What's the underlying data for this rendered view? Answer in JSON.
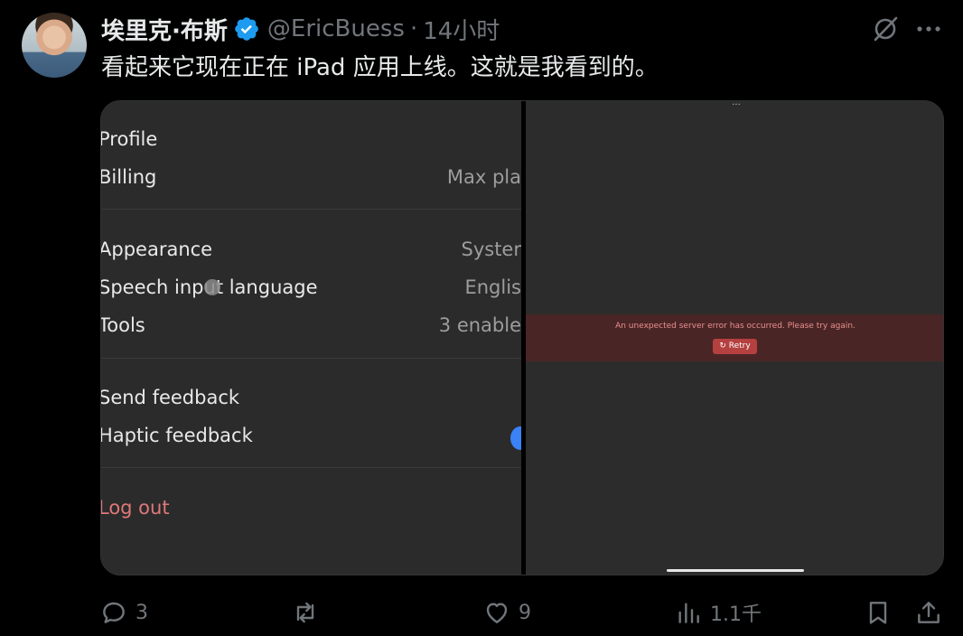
{
  "tweet": {
    "author": "埃里克·布斯",
    "handle": "@EricBuess",
    "separator": "·",
    "time": "14小时",
    "text": "看起来它现在正在 iPad 应用上线。这就是我看到的。"
  },
  "media": {
    "settings": {
      "profile": "Profile",
      "billing": "Billing",
      "billing_value": "Max pla",
      "appearance": "Appearance",
      "appearance_value": "Syster",
      "speech": "Speech input language",
      "speech_value": "Englis",
      "tools": "Tools",
      "tools_value": "3 enable",
      "send_feedback": "Send feedback",
      "haptic": "Haptic feedback",
      "logout": "Log out"
    },
    "handle_dots": "···",
    "error": {
      "message": "An unexpected server error has occurred. Please try again.",
      "retry": "Retry",
      "retry_icon": "↻"
    }
  },
  "actions": {
    "replies": "3",
    "retweets": "",
    "likes": "9",
    "views": "1.1千"
  },
  "icons": [
    "verified-badge-icon",
    "grok-icon",
    "more-icon",
    "reply-icon",
    "retweet-icon",
    "like-icon",
    "views-icon",
    "bookmark-icon",
    "share-icon"
  ],
  "colors": {
    "background": "#000000",
    "verified": "#1d9bf0",
    "secondary_text": "#71767b",
    "error_banner": "#4a2525",
    "retry_button": "#b54040",
    "logout": "#e0787a"
  }
}
